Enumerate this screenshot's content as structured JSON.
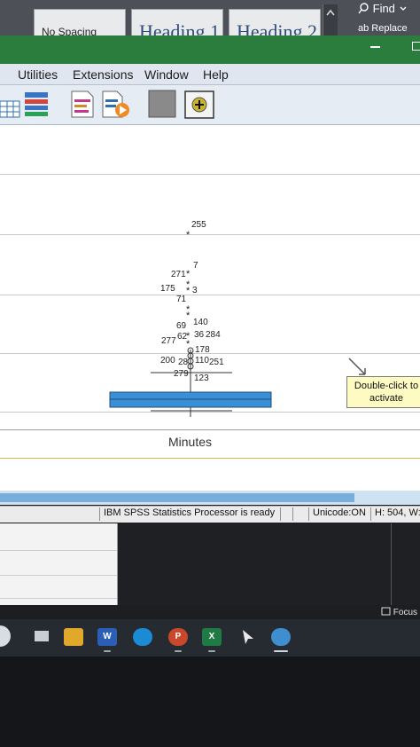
{
  "word": {
    "styles": [
      "No Spacing",
      "Heading 1",
      "Heading 2"
    ],
    "find_label": "Find",
    "replace_label": "Replace"
  },
  "menu": [
    "Utilities",
    "Extensions",
    "Window",
    "Help"
  ],
  "toolbar_icons": [
    "table-icon",
    "chart-icon",
    "syntax-icon",
    "run-icon",
    "grey-box-icon",
    "add-icon"
  ],
  "boxplot": {
    "outliers": [
      {
        "label": "255"
      },
      {
        "label": "7"
      },
      {
        "label": "271"
      },
      {
        "label": "175"
      },
      {
        "label": "3"
      },
      {
        "label": "71"
      },
      {
        "label": "69"
      },
      {
        "label": "140"
      },
      {
        "label": "62"
      },
      {
        "label": "36"
      },
      {
        "label": "284"
      },
      {
        "label": "277"
      },
      {
        "label": "178"
      },
      {
        "label": "200"
      },
      {
        "label": "28"
      },
      {
        "label": "110"
      },
      {
        "label": "251"
      },
      {
        "label": "279"
      },
      {
        "label": "123"
      }
    ],
    "variable_label": "Minutes"
  },
  "tooltip": {
    "text": "Double-click to activate"
  },
  "status": {
    "processor": "IBM SPSS Statistics Processor is ready",
    "unicode": "Unicode:ON",
    "dims": "H: 504, W:"
  },
  "focus_label": "Focus",
  "taskbar": {
    "word_letter": "W",
    "ppt_letter": "P",
    "excel_letter": "X"
  },
  "colors": {
    "spss_green": "#2a7d3c",
    "box_fill": "#3a8fd6",
    "tooltip_bg": "#fdfbc2"
  }
}
